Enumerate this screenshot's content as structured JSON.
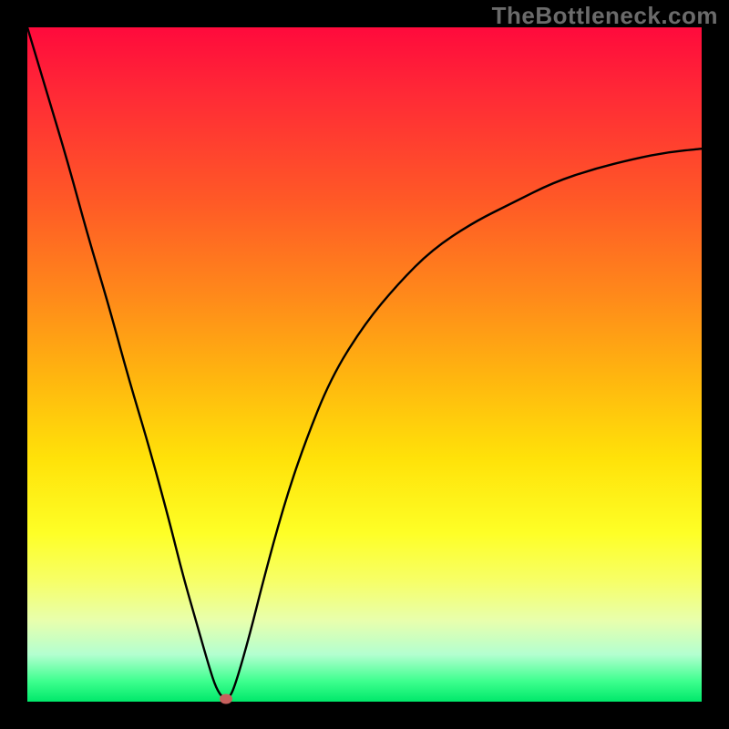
{
  "watermark": "TheBottleneck.com",
  "chart_data": {
    "type": "line",
    "title": "",
    "xlabel": "",
    "ylabel": "",
    "xlim": [
      0,
      100
    ],
    "ylim": [
      0,
      100
    ],
    "grid": false,
    "legend": false,
    "background_gradient": {
      "orientation": "vertical",
      "stops": [
        {
          "pos": 0.0,
          "color": "#ff0a3c"
        },
        {
          "pos": 0.26,
          "color": "#ff5a26"
        },
        {
          "pos": 0.52,
          "color": "#ffb60f"
        },
        {
          "pos": 0.75,
          "color": "#feff26"
        },
        {
          "pos": 0.93,
          "color": "#b3ffd0"
        },
        {
          "pos": 1.0,
          "color": "#00e86a"
        }
      ]
    },
    "series": [
      {
        "name": "bottleneck-curve",
        "x": [
          0,
          3,
          6,
          9,
          12,
          15,
          18,
          21,
          23,
          25,
          27,
          28,
          29,
          30,
          31,
          33,
          35,
          38,
          41,
          45,
          50,
          55,
          60,
          66,
          72,
          78,
          84,
          90,
          95,
          100
        ],
        "y": [
          100,
          90,
          80,
          69,
          59,
          48,
          38,
          27,
          19,
          12,
          5,
          2,
          0.5,
          0.5,
          3,
          10,
          18,
          29,
          38,
          48,
          56,
          62,
          67,
          71,
          74,
          77,
          79,
          80.5,
          81.5,
          82
        ]
      }
    ],
    "marker": {
      "x": 29.5,
      "y": 0.4
    },
    "notes": "Values estimated visually from an unlabeled plot; y-axis interpreted as percentage (top=100, bottom=0). Minimum of curve near x≈29.5."
  }
}
